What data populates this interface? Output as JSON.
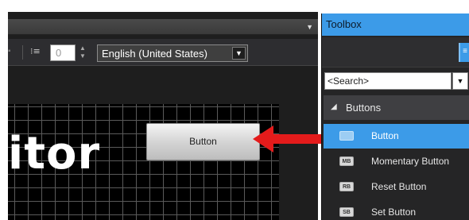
{
  "editor": {
    "spacing_value": "0",
    "language": "English (United States)",
    "title_fragment": "itor",
    "canvas_button_label": "Button"
  },
  "toolbox": {
    "title": "Toolbox",
    "search_placeholder": "<Search>",
    "group": "Buttons",
    "items": [
      {
        "icon": "",
        "label": "Button",
        "selected": true
      },
      {
        "icon": "MB",
        "label": "Momentary Button",
        "selected": false
      },
      {
        "icon": "RB",
        "label": "Reset Button",
        "selected": false
      },
      {
        "icon": "SB",
        "label": "Set Button",
        "selected": false
      }
    ]
  },
  "colors": {
    "accent": "#3c9be8",
    "arrow": "#e41b1b",
    "editor_background": "#1e1e1e",
    "panel_background": "#252526"
  }
}
